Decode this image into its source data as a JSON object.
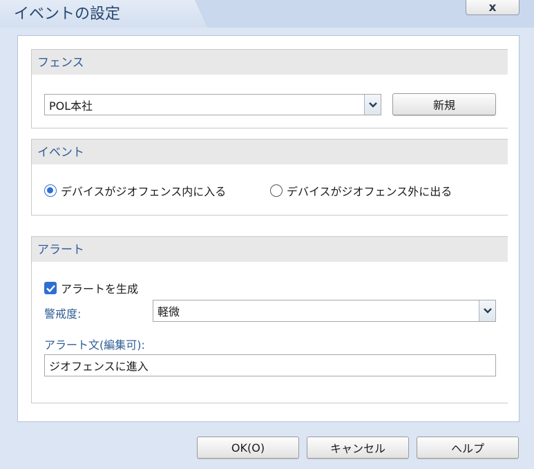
{
  "window": {
    "title": "イベントの設定",
    "close_label": "x"
  },
  "fence": {
    "header": "フェンス",
    "selected": "POL本社",
    "new_button": "新規"
  },
  "event": {
    "header": "イベント",
    "options": [
      {
        "label": "デバイスがジオフェンス内に入る",
        "selected": true
      },
      {
        "label": "デバイスがジオフェンス外に出る",
        "selected": false
      }
    ]
  },
  "alert": {
    "header": "アラート",
    "generate_label": "アラートを生成",
    "generate_checked": true,
    "severity_label": "警戒度:",
    "severity_value": "軽微",
    "message_label": "アラート文(編集可):",
    "message_value": "ジオフェンスに進入"
  },
  "footer": {
    "ok": "OK(O)",
    "cancel": "キャンセル",
    "help": "ヘルプ"
  },
  "colors": {
    "accent": "#2f6fd0",
    "header_text": "#2f5d96",
    "background": "#dbe5f3"
  }
}
